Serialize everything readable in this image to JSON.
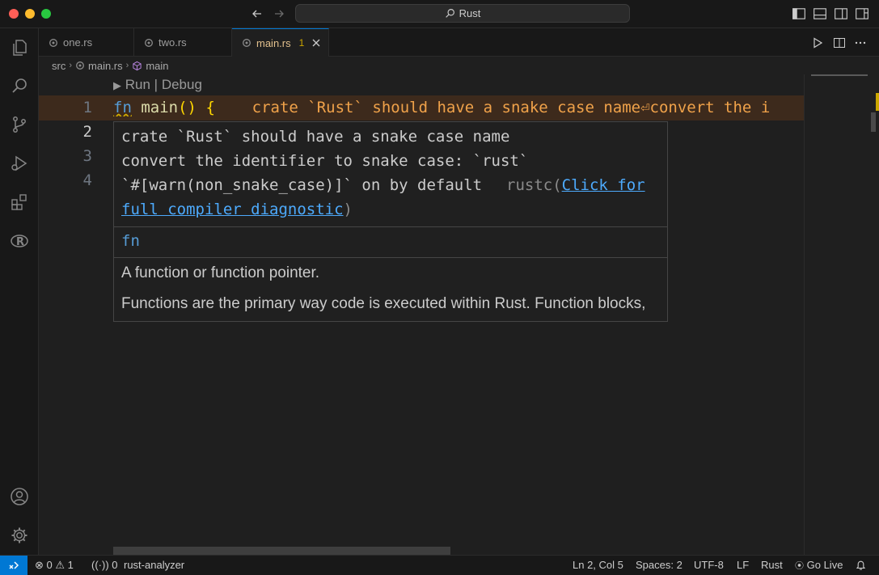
{
  "titlebar": {
    "search_text": "Rust"
  },
  "tabs": [
    {
      "label": "one.rs"
    },
    {
      "label": "two.rs"
    },
    {
      "label": "main.rs",
      "badge": "1"
    }
  ],
  "breadcrumb": {
    "folder": "src",
    "file": "main.rs",
    "symbol": "main"
  },
  "codelens": {
    "run": "Run",
    "sep": "|",
    "debug": "Debug"
  },
  "editor": {
    "line_numbers": [
      "1",
      "2",
      "3",
      "4"
    ],
    "line1": {
      "kw": "fn",
      "fname": "main",
      "parens": "()",
      "brace": "{",
      "inline_diag": "crate `Rust` should have a snake case name⏎convert the i"
    }
  },
  "hover": {
    "diag_line1": "crate `Rust` should have a snake case name",
    "diag_line2": "convert the identifier to snake case: `rust`",
    "diag_line3": "`#[warn(non_snake_case)]` on by default",
    "source": "rustc(",
    "link_part1": "Click for",
    "link_part2": "full compiler diagnostic",
    "close_paren": ")",
    "keyword": "fn",
    "doc_line1": "A function or function pointer.",
    "doc_line2": "Functions are the primary way code is executed within Rust. Function blocks,"
  },
  "statusbar": {
    "errors": "0",
    "warnings": "1",
    "ports": "0",
    "server": "rust-analyzer",
    "position": "Ln 2, Col 5",
    "spaces": "Spaces: 2",
    "encoding": "UTF-8",
    "eol": "LF",
    "language": "Rust",
    "golive": "Go Live"
  },
  "colors": {
    "accent": "#0078d4",
    "warning": "#cca700",
    "modified_tab": "#e2c08d"
  }
}
